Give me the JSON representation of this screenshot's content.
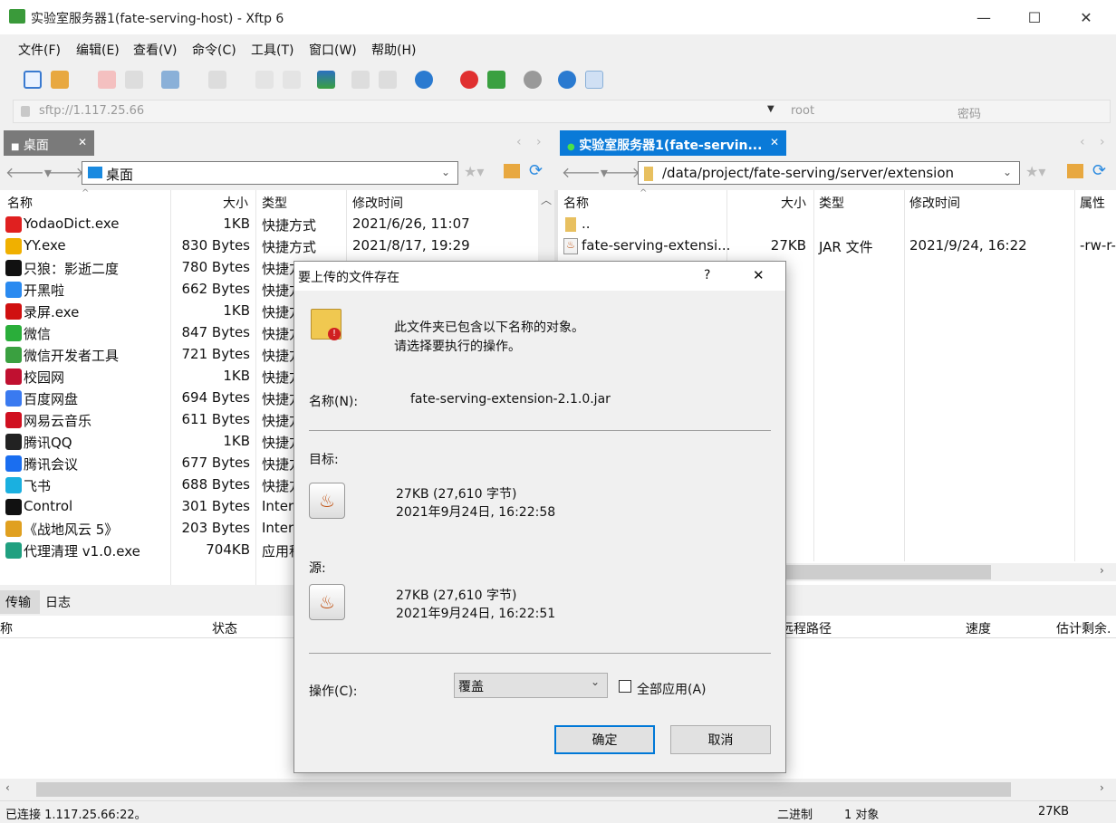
{
  "window": {
    "title": "实验室服务器1(fate-serving-host) - Xftp 6",
    "minimize": "—",
    "maximize": "☐",
    "close": "✕"
  },
  "menu": [
    "文件(F)",
    "编辑(E)",
    "查看(V)",
    "命令(C)",
    "工具(T)",
    "窗口(W)",
    "帮助(H)"
  ],
  "address": {
    "url": "sftp://1.117.25.66",
    "user_placeholder": "root",
    "password_placeholder": "密码"
  },
  "left": {
    "tab": "桌面",
    "path": "桌面",
    "columns": [
      "名称",
      "大小",
      "类型",
      "修改时间"
    ],
    "rows": [
      {
        "name": "YodaoDict.exe",
        "size": "1KB",
        "type": "快捷方式",
        "modified": "2021/6/26, 11:07",
        "icon": "youdao-icon",
        "color": "#e02020"
      },
      {
        "name": "YY.exe",
        "size": "830 Bytes",
        "type": "快捷方式",
        "modified": "2021/8/17, 19:29",
        "icon": "yy-icon",
        "color": "#f0b000"
      },
      {
        "name": "只狼：影逝二度",
        "size": "780 Bytes",
        "type": "快捷方",
        "modified": "",
        "icon": "sekiro-icon",
        "color": "#111111"
      },
      {
        "name": "开黑啦",
        "size": "662 Bytes",
        "type": "快捷方",
        "modified": "",
        "icon": "kaiheila-icon",
        "color": "#2a8af0"
      },
      {
        "name": "录屏.exe",
        "size": "1KB",
        "type": "快捷方",
        "modified": "",
        "icon": "recorder-icon",
        "color": "#d01010"
      },
      {
        "name": "微信",
        "size": "847 Bytes",
        "type": "快捷方",
        "modified": "",
        "icon": "wechat-icon",
        "color": "#2aae3a"
      },
      {
        "name": "微信开发者工具",
        "size": "721 Bytes",
        "type": "快捷方",
        "modified": "",
        "icon": "wechat-devtools-icon",
        "color": "#3aa040"
      },
      {
        "name": "校园网",
        "size": "1KB",
        "type": "快捷方",
        "modified": "",
        "icon": "campus-net-icon",
        "color": "#c01030"
      },
      {
        "name": "百度网盘",
        "size": "694 Bytes",
        "type": "快捷方",
        "modified": "",
        "icon": "baidu-netdisk-icon",
        "color": "#3a7af0"
      },
      {
        "name": "网易云音乐",
        "size": "611 Bytes",
        "type": "快捷方",
        "modified": "",
        "icon": "netease-music-icon",
        "color": "#d01020"
      },
      {
        "name": "腾讯QQ",
        "size": "1KB",
        "type": "快捷方",
        "modified": "",
        "icon": "qq-icon",
        "color": "#222222"
      },
      {
        "name": "腾讯会议",
        "size": "677 Bytes",
        "type": "快捷方",
        "modified": "",
        "icon": "tencent-meeting-icon",
        "color": "#1a6ef0"
      },
      {
        "name": "飞书",
        "size": "688 Bytes",
        "type": "快捷方",
        "modified": "",
        "icon": "feishu-icon",
        "color": "#1ab0e0"
      },
      {
        "name": "Control",
        "size": "301 Bytes",
        "type": "Intern",
        "modified": "",
        "icon": "control-icon",
        "color": "#111111"
      },
      {
        "name": "《战地风云 5》",
        "size": "203 Bytes",
        "type": "Intern",
        "modified": "",
        "icon": "battlefield-icon",
        "color": "#e0a020"
      },
      {
        "name": "代理清理 v1.0.exe",
        "size": "704KB",
        "type": "应用程",
        "modified": "",
        "icon": "proxy-clean-icon",
        "color": "#20a080"
      }
    ]
  },
  "right": {
    "tab": "实验室服务器1(fate-servin...",
    "path": "/data/project/fate-serving/server/extension",
    "columns": [
      "名称",
      "大小",
      "类型",
      "修改时间",
      "属性"
    ],
    "rows": [
      {
        "name": "..",
        "size": "",
        "type": "",
        "modified": "",
        "attr": ""
      },
      {
        "name": "fate-serving-extensi...",
        "size": "27KB",
        "type": "JAR 文件",
        "modified": "2021/9/24, 16:22",
        "attr": "-rw-r-"
      }
    ]
  },
  "bottom": {
    "tabs": [
      "传输",
      "日志"
    ],
    "columns": [
      "称",
      "状态",
      "远程路径",
      "速度",
      "估计剩余."
    ]
  },
  "status": {
    "connection": "已连接 1.117.25.66:22。",
    "mode": "二进制",
    "objects": "1 对象",
    "size": "27KB"
  },
  "dialog": {
    "title": "要上传的文件存在",
    "help": "?",
    "close": "✕",
    "message1": "此文件夹已包含以下名称的对象。",
    "message2": "请选择要执行的操作。",
    "name_label": "名称(N):",
    "name_value": "fate-serving-extension-2.1.0.jar",
    "target_label": "目标:",
    "target_size": "27KB (27,610 字节)",
    "target_date": "2021年9月24日, 16:22:58",
    "source_label": "源:",
    "source_size": "27KB (27,610 字节)",
    "source_date": "2021年9月24日, 16:22:51",
    "action_label": "操作(C):",
    "action_value": "覆盖",
    "apply_all": "全部应用(A)",
    "ok": "确定",
    "cancel": "取消"
  }
}
